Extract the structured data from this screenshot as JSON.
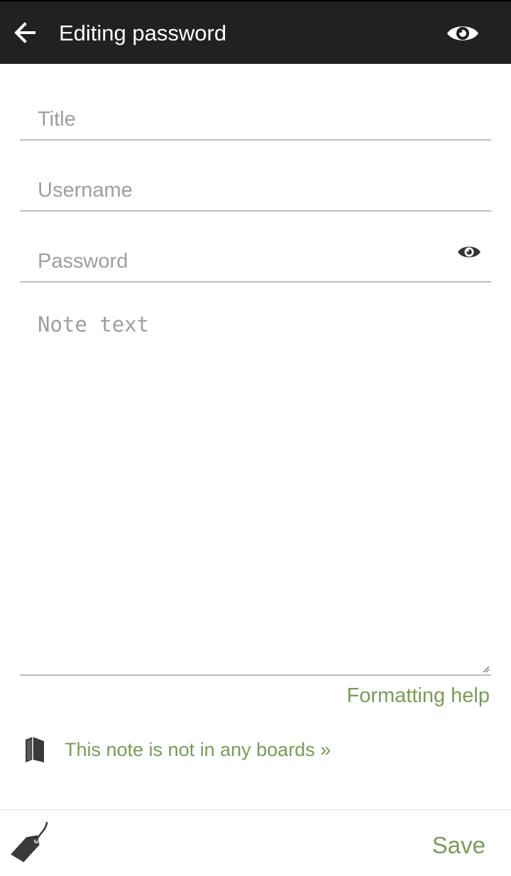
{
  "header": {
    "title": "Editing password",
    "back_icon": "arrow-left-icon",
    "visibility_icon": "eye-icon",
    "background": "#212121"
  },
  "form": {
    "title_placeholder": "Title",
    "title_value": "",
    "username_placeholder": "Username",
    "username_value": "",
    "password_placeholder": "Password",
    "password_value": "",
    "password_toggle_icon": "eye-icon",
    "note_placeholder": "Note text",
    "note_value": ""
  },
  "formatting_help": "Formatting help",
  "boards": {
    "icon": "book-icon",
    "text": "This note is not in any boards »"
  },
  "footer": {
    "tag_icon": "tag-icon",
    "save_label": "Save"
  },
  "colors": {
    "accent": "#7b9b58",
    "divider": "#bdbdbd",
    "placeholder": "#9e9e9e"
  }
}
